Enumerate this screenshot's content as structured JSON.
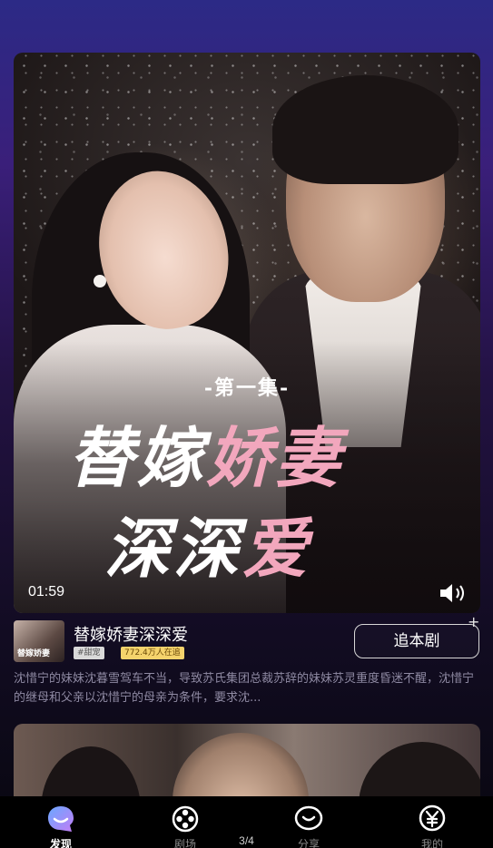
{
  "video": {
    "episode_label": "-第一集-",
    "title_line1_white": "替嫁",
    "title_line1_pink": "娇妻",
    "title_line2_white": "深深",
    "title_line2_pink": "爱",
    "timestamp": "01:59"
  },
  "drama": {
    "thumbnail_text": "替嫁娇妻",
    "title": "替嫁娇妻深深爱",
    "genre_tag": "#甜宠",
    "watchers_tag": "772.4万人在追",
    "follow_label": "追本剧",
    "follow_plus": "+",
    "description": "沈惜宁的妹妹沈暮雪驾车不当，导致苏氏集团总裁苏辞的妹妹苏灵重度昏迷不醒，沈惜宁的继母和父亲以沈惜宁的母亲为条件，要求沈..."
  },
  "bottom_nav": {
    "items": [
      {
        "label": "发现",
        "icon": "discover-icon",
        "active": true
      },
      {
        "label": "剧场",
        "icon": "film-reel-icon",
        "active": false
      },
      {
        "label": "分享",
        "icon": "share-icon",
        "active": false
      },
      {
        "label": "我的",
        "icon": "profile-yen-icon",
        "active": false
      }
    ]
  },
  "page_indicator": "3/4",
  "colors": {
    "accent_pink": "#f2a7bd",
    "watchers_tag": "#f5d36c",
    "nav_active_icon": "#b48cf0"
  }
}
